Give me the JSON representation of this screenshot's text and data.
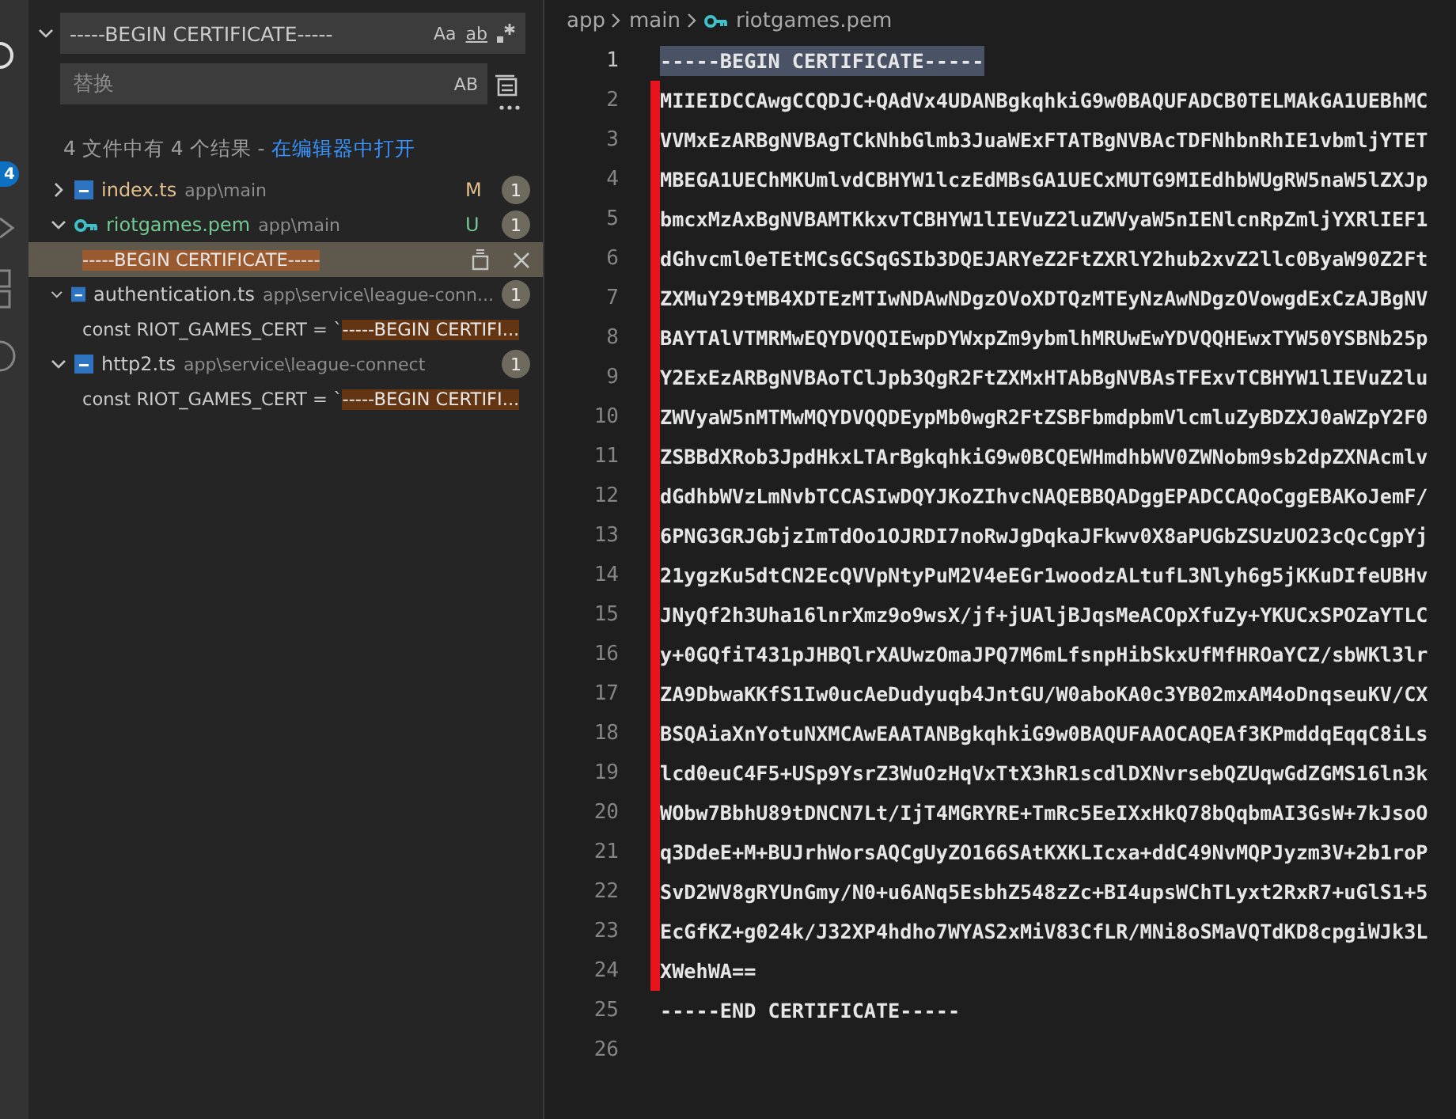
{
  "activity_bar": {
    "badge": "4"
  },
  "search": {
    "value": "-----BEGIN CERTIFICATE-----",
    "expanded": true,
    "toggles": [
      "Aa",
      "ab"
    ]
  },
  "replace": {
    "placeholder": "替换",
    "toggle": "AB"
  },
  "summary": {
    "text": "4 文件中有 4 个结果 - ",
    "link": "在编辑器中打开"
  },
  "results": [
    {
      "name": "index.ts",
      "path": "app\\main",
      "kind": "ts",
      "status": "M",
      "count": "1",
      "expanded": false
    },
    {
      "name": "riotgames.pem",
      "path": "app\\main",
      "kind": "key",
      "status": "U",
      "count": "1",
      "expanded": true,
      "matches": [
        {
          "match": "-----BEGIN CERTIFICATE-----",
          "selected": true
        }
      ]
    },
    {
      "name": "authentication.ts",
      "path": "app\\service\\league-conn...",
      "kind": "ts",
      "count": "1",
      "expanded": true,
      "matches": [
        {
          "prefix": "const RIOT_GAMES_CERT = `",
          "match": "-----BEGIN CERTIFI...",
          "selected": false
        }
      ]
    },
    {
      "name": "http2.ts",
      "path": "app\\service\\league-connect",
      "kind": "ts",
      "count": "1",
      "expanded": true,
      "matches": [
        {
          "prefix": "const RIOT_GAMES_CERT = `",
          "match": "-----BEGIN CERTIFI...",
          "selected": false
        }
      ]
    }
  ],
  "breadcrumbs": [
    {
      "label": "app",
      "kind": "folder"
    },
    {
      "label": "main",
      "kind": "folder"
    },
    {
      "label": "riotgames.pem",
      "kind": "key"
    }
  ],
  "lines": [
    {
      "number": "1",
      "text": "-----BEGIN CERTIFICATE-----",
      "selected": true,
      "marked": false
    },
    {
      "number": "2",
      "text": "MIIEIDCCAwgCCQDJC+QAdVx4UDANBgkqhkiG9w0BAQUFADCB0TELMAkGA1UEBhMC",
      "selected": false,
      "marked": true
    },
    {
      "number": "3",
      "text": "VVMxEzARBgNVBAgTCkNhbGlmb3JuaWExFTATBgNVBAcTDFNhbnRhIE1vbmljYTET",
      "selected": false,
      "marked": true
    },
    {
      "number": "4",
      "text": "MBEGA1UEChMKUmlvdCBHYW1lczEdMBsGA1UECxMUTG9MIEdhbWUgRW5naW5lZXJp",
      "selected": false,
      "marked": true
    },
    {
      "number": "5",
      "text": "bmcxMzAxBgNVBAMTKkxvTCBHYW1lIEVuZ2luZWVyaW5nIENlcnRpZmljYXRlIEF1",
      "selected": false,
      "marked": true
    },
    {
      "number": "6",
      "text": "dGhvcml0eTEtMCsGCSqGSIb3DQEJARYeZ2FtZXRlY2hub2xvZ2llc0ByaW90Z2Ft",
      "selected": false,
      "marked": true
    },
    {
      "number": "7",
      "text": "ZXMuY29tMB4XDTEzMTIwNDAwNDgzOVoXDTQzMTEyNzAwNDgzOVowgdExCzAJBgNV",
      "selected": false,
      "marked": true
    },
    {
      "number": "8",
      "text": "BAYTAlVTMRMwEQYDVQQIEwpDYWxpZm9ybmlhMRUwEwYDVQQHEwxTYW50YSBNb25p",
      "selected": false,
      "marked": true
    },
    {
      "number": "9",
      "text": "Y2ExEzARBgNVBAoTClJpb3QgR2FtZXMxHTAbBgNVBAsTFExvTCBHYW1lIEVuZ2lu",
      "selected": false,
      "marked": true
    },
    {
      "number": "10",
      "text": "ZWVyaW5nMTMwMQYDVQQDEypMb0wgR2FtZSBFbmdpbmVlcmluZyBDZXJ0aWZpY2F0",
      "selected": false,
      "marked": true
    },
    {
      "number": "11",
      "text": "ZSBBdXRob3JpdHkxLTArBgkqhkiG9w0BCQEWHmdhbWV0ZWNobm9sb2dpZXNAcmlv",
      "selected": false,
      "marked": true
    },
    {
      "number": "12",
      "text": "dGdhbWVzLmNvbTCCASIwDQYJKoZIhvcNAQEBBQADggEPADCCAQoCggEBAKoJemF/",
      "selected": false,
      "marked": true
    },
    {
      "number": "13",
      "text": "6PNG3GRJGbjzImTdOo1OJRDI7noRwJgDqkaJFkwv0X8aPUGbZSUzUO23cQcCgpYj",
      "selected": false,
      "marked": true
    },
    {
      "number": "14",
      "text": "21ygzKu5dtCN2EcQVVpNtyPuM2V4eEGr1woodzALtufL3Nlyh6g5jKKuDIfeUBHv",
      "selected": false,
      "marked": true
    },
    {
      "number": "15",
      "text": "JNyQf2h3Uha16lnrXmz9o9wsX/jf+jUAljBJqsMeACOpXfuZy+YKUCxSPOZaYTLC",
      "selected": false,
      "marked": true
    },
    {
      "number": "16",
      "text": "y+0GQfiT431pJHBQlrXAUwzOmaJPQ7M6mLfsnpHibSkxUfMfHROaYCZ/sbWKl3lr",
      "selected": false,
      "marked": true
    },
    {
      "number": "17",
      "text": "ZA9DbwaKKfS1Iw0ucAeDudyuqb4JntGU/W0aboKA0c3YB02mxAM4oDnqseuKV/CX",
      "selected": false,
      "marked": true
    },
    {
      "number": "18",
      "text": "BSQAiaXnYotuNXMCAwEAATANBgkqhkiG9w0BAQUFAAOCAQEAf3KPmddqEqqC8iLs",
      "selected": false,
      "marked": true
    },
    {
      "number": "19",
      "text": "lcd0euC4F5+USp9YsrZ3WuOzHqVxTtX3hR1scdlDXNvrsebQZUqwGdZGMS16ln3k",
      "selected": false,
      "marked": true
    },
    {
      "number": "20",
      "text": "WObw7BbhU89tDNCN7Lt/IjT4MGRYRE+TmRc5EeIXxHkQ78bQqbmAI3GsW+7kJsoO",
      "selected": false,
      "marked": true
    },
    {
      "number": "21",
      "text": "q3DdeE+M+BUJrhWorsAQCgUyZO166SAtKXKLIcxa+ddC49NvMQPJyzm3V+2b1roP",
      "selected": false,
      "marked": true
    },
    {
      "number": "22",
      "text": "SvD2WV8gRYUnGmy/N0+u6ANq5EsbhZ548zZc+BI4upsWChTLyxt2RxR7+uGlS1+5",
      "selected": false,
      "marked": true
    },
    {
      "number": "23",
      "text": "EcGfKZ+g024k/J32XP4hdho7WYAS2xMiV83CfLR/MNi8oSMaVQTdKD8cpgiWJk3L",
      "selected": false,
      "marked": true
    },
    {
      "number": "24",
      "text": "XWehWA==",
      "selected": false,
      "marked": true
    },
    {
      "number": "25",
      "text": "-----END CERTIFICATE-----",
      "selected": false,
      "marked": false
    },
    {
      "number": "26",
      "selected": false,
      "marked": false
    }
  ]
}
